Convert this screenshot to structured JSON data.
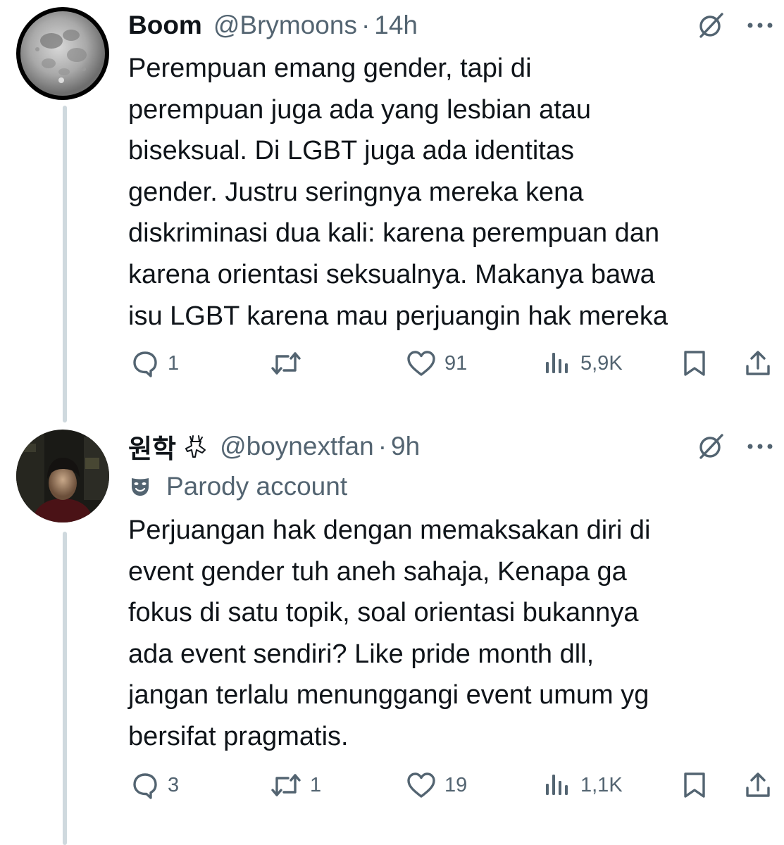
{
  "tweets": [
    {
      "display_name": "Boom",
      "handle": "@Brymoons",
      "separator": "·",
      "time": "14h",
      "body_lines": [
        "Perempuan emang gender, tapi di",
        "perempuan juga ada yang lesbian atau",
        "biseksual. Di LGBT juga ada identitas",
        "gender. Justru seringnya mereka kena",
        "diskriminasi dua kali: karena perempuan dan",
        "karena orientasi seksualnya. Makanya bawa",
        "isu LGBT karena mau perjuangin hak mereka"
      ],
      "replies": "1",
      "reposts": "",
      "likes": "91",
      "views": "5,9K",
      "icons": [
        "moon-avatar",
        "grok-icon",
        "more-icon",
        "reply-icon",
        "repost-icon",
        "like-icon",
        "views-icon",
        "bookmark-icon",
        "share-icon"
      ]
    },
    {
      "display_name": "원학",
      "name_badge_icon": "deer-icon",
      "handle": "@boynextfan",
      "separator": "·",
      "time": "9h",
      "label": "Parody account",
      "label_icon": "theater-mask-icon",
      "body_lines": [
        "Perjuangan hak dengan memaksakan diri di",
        "event gender tuh aneh sahaja, Kenapa ga",
        "fokus di satu topik, soal orientasi bukannya",
        "ada event sendiri? Like pride month dll,",
        "jangan terlalu menunggangi event umum yg",
        "bersifat pragmatis."
      ],
      "replies": "3",
      "reposts": "1",
      "likes": "19",
      "views": "1,1K"
    }
  ],
  "colors": {
    "text_primary": "#0f1419",
    "text_secondary": "#536471",
    "thread_line": "#cfd9de",
    "background": "#ffffff"
  }
}
